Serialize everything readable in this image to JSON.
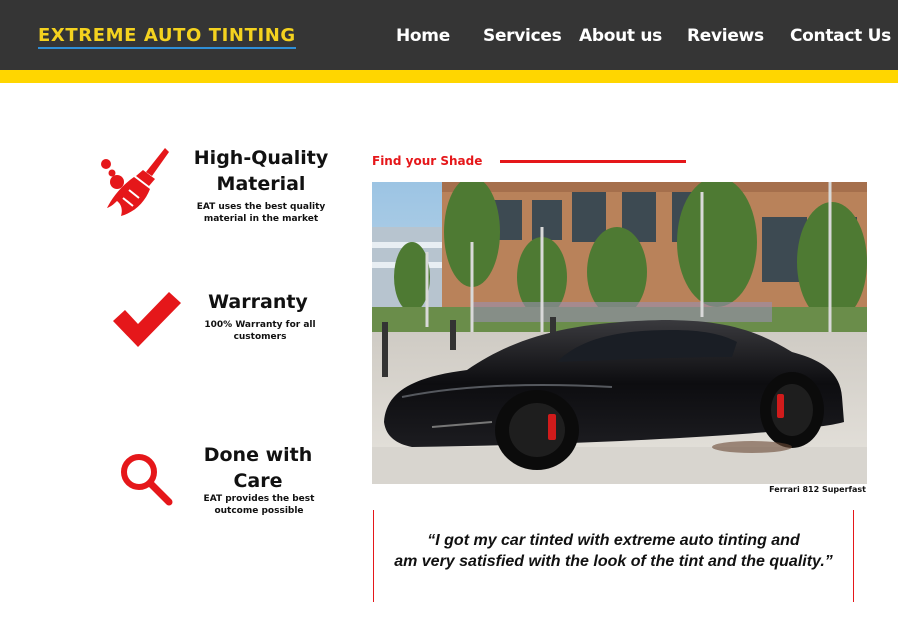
{
  "header": {
    "brand": "EXTREME AUTO TINTING",
    "nav": [
      "Home",
      "Services",
      "About us",
      "Reviews",
      "Contact Us"
    ]
  },
  "features": [
    {
      "icon": "broom-icon",
      "title": "High-Quality Material",
      "desc": "EAT uses the best quality material in the market"
    },
    {
      "icon": "checkmark-icon",
      "title": "Warranty",
      "desc": "100% Warranty for all customers"
    },
    {
      "icon": "search-icon",
      "title": "Done with Care",
      "desc": "EAT provides the best outcome possible"
    }
  ],
  "shade": {
    "label": "Find your Shade"
  },
  "photo": {
    "caption": "Ferrari 812 Superfast"
  },
  "testimonial": {
    "line1": "“I got my car tinted with extreme auto tinting and",
    "line2": "am very satisfied with the look of the tint and the quality.”"
  },
  "colors": {
    "header_bg": "#353535",
    "accent_yellow": "#ffd600",
    "accent_red": "#e5171a",
    "brand_text": "#f4d21f"
  }
}
